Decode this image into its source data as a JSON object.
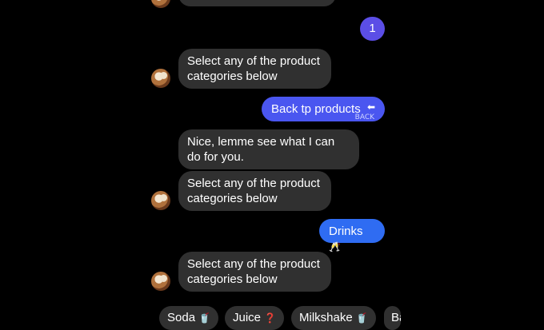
{
  "top_partial": {
    "text": ""
  },
  "messages": {
    "user_1": "1",
    "bot_select_1": "Select any of the product categories below",
    "user_back": "Back tp products",
    "user_back_emoji": "⬅",
    "user_back_sticker": "BACK",
    "bot_nice": "Nice, lemme see what I can do for you.",
    "bot_select_2": "Select any of the product categories below",
    "user_drinks": "Drinks",
    "user_drinks_emoji": "🥂",
    "bot_select_3": "Select any of the product categories below"
  },
  "quick_replies": [
    {
      "label": "Soda",
      "emoji": "🥤"
    },
    {
      "label": "Juice",
      "emoji": "❓"
    },
    {
      "label": "Milkshake",
      "emoji": "🥤"
    },
    {
      "label": "Ba",
      "emoji": ""
    }
  ]
}
